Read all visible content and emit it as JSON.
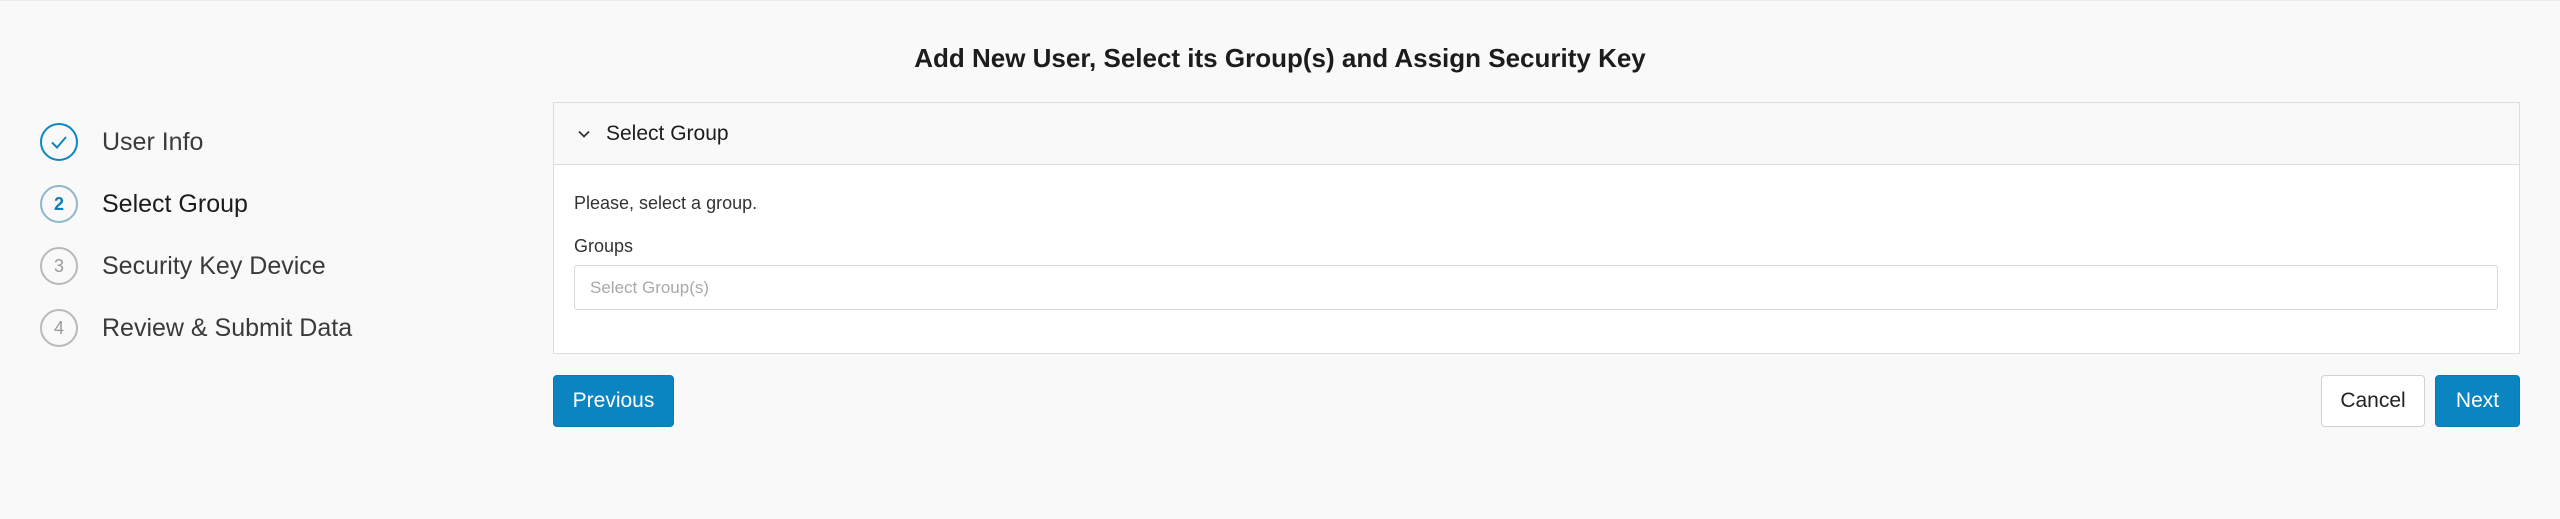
{
  "page": {
    "title": "Add New User, Select its Group(s) and Assign Security Key"
  },
  "stepper": {
    "steps": [
      {
        "number": "",
        "label": "User Info",
        "state": "done",
        "icon": "check-icon"
      },
      {
        "number": "2",
        "label": "Select Group",
        "state": "active"
      },
      {
        "number": "3",
        "label": "Security Key Device",
        "state": "pending"
      },
      {
        "number": "4",
        "label": "Review & Submit Data",
        "state": "pending"
      }
    ]
  },
  "panel": {
    "title": "Select Group",
    "toggle_icon": "chevron-down-icon",
    "hint": "Please, select a group.",
    "groups_label": "Groups",
    "groups_placeholder": "Select Group(s)"
  },
  "actions": {
    "previous_label": "Previous",
    "cancel_label": "Cancel",
    "next_label": "Next"
  },
  "colors": {
    "accent": "#0a85c2",
    "background": "#f9f9f9"
  }
}
